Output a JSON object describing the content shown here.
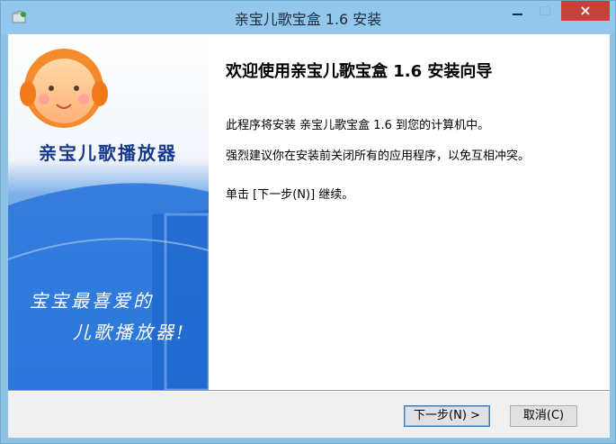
{
  "window": {
    "title": "亲宝儿歌宝盒 1.6 安装",
    "app_icon": "installer-icon",
    "controls": {
      "minimize": "minimize-icon",
      "maximize": "maximize-icon",
      "close": "×"
    }
  },
  "sidebar": {
    "brand": "亲宝儿歌播放器",
    "slogan_line1": "宝宝最喜爱的",
    "slogan_line2": "儿歌播放器!"
  },
  "content": {
    "heading": "欢迎使用亲宝儿歌宝盒 1.6 安装向导",
    "para1": "此程序将安装 亲宝儿歌宝盒 1.6 到您的计算机中。",
    "para2": " 强烈建议你在安装前关闭所有的应用程序，以免互相冲突。",
    "para3": "单击 [下一步(N)] 继续。"
  },
  "buttons": {
    "next": "下一步(N) >",
    "cancel": "取消(C)"
  },
  "colors": {
    "titlebar": "#93c7ec",
    "close": "#c7403a",
    "sidebar_blue": "#2a74d8",
    "brand_text": "#173a8c"
  }
}
